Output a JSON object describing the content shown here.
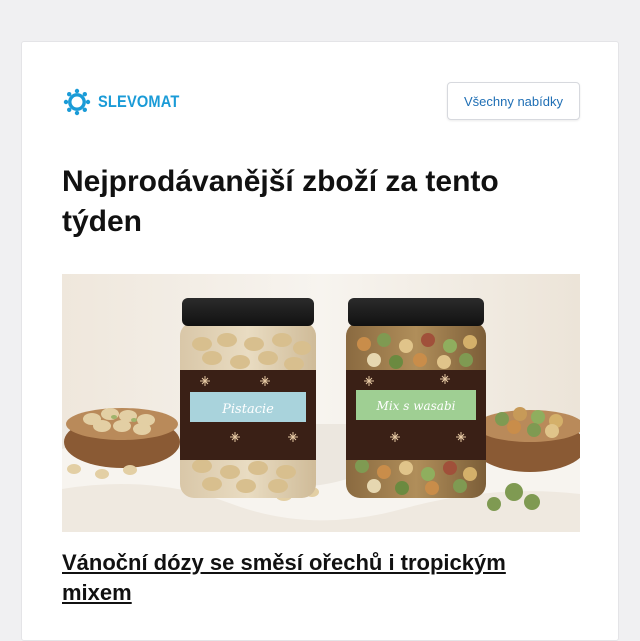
{
  "brand": {
    "name": "SLEVOMAT",
    "logo_icon": "gear-icon",
    "accent_color": "#1a9bd7"
  },
  "header": {
    "all_offers_label": "Všechny nabídky"
  },
  "main": {
    "title": "Nejprodávanější zboží za tento týden",
    "product": {
      "image": "photo-of-two-jars-of-nuts",
      "jar_labels": [
        "Pistacie",
        "Mix s wasabi"
      ],
      "title": "Vánoční dózy se směsí ořechů i tropickým mixem"
    }
  }
}
